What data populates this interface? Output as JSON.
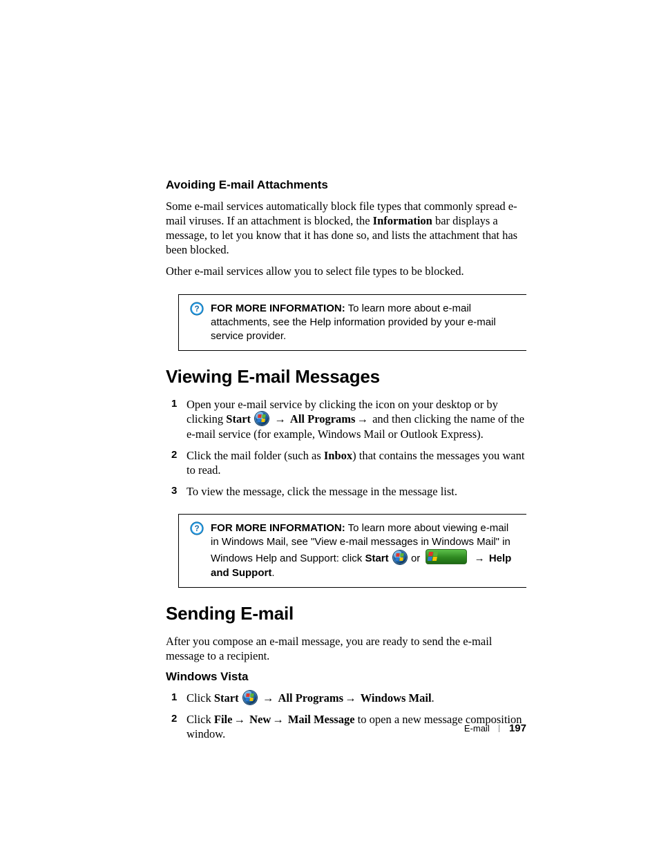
{
  "section1": {
    "heading": "Avoiding E-mail Attachments",
    "p1a": "Some e-mail services automatically block file types that commonly spread e-mail viruses. If an attachment is blocked, the ",
    "p1b": "Information",
    "p1c": " bar displays a message, to let you know that it has done so, and lists the attachment that has been blocked.",
    "p2": "Other e-mail services allow you to select file types to be blocked."
  },
  "note1": {
    "label": "FOR MORE INFORMATION:",
    "text": " To learn more about e-mail attachments, see the Help information provided by your e-mail service provider."
  },
  "section2": {
    "heading": "Viewing E-mail Messages",
    "step1a": "Open your e-mail service by clicking the icon on your desktop or by clicking ",
    "step1_start": "Start",
    "step1_arrow1": " → ",
    "step1_allprograms": "All Programs",
    "step1_arrow2": "→ ",
    "step1b": "and then clicking the name of the e-mail service (for example, Windows Mail or Outlook Express).",
    "step2a": "Click the mail folder (such as ",
    "step2_inbox": "Inbox",
    "step2b": ") that contains the messages you want to read.",
    "step3": "To view the message, click the message in the message list."
  },
  "note2": {
    "label": "FOR MORE INFORMATION:",
    "t1": " To learn more about viewing e-mail in Windows Mail, see \"View e-mail messages in Windows Mail\" in Windows Help and Support: click ",
    "start": "Start",
    "or": " or ",
    "arrow": " → ",
    "help": "Help and Support",
    "period": "."
  },
  "section3": {
    "heading": "Sending E-mail",
    "intro": "After you compose an e-mail message, you are ready to send the e-mail message to a recipient.",
    "sub": "Windows Vista",
    "s1a": "Click ",
    "s1_start": "Start",
    "s1_arrow1": " → ",
    "s1_all": "All Programs",
    "s1_arrow2": "→ ",
    "s1_wm": "Windows Mail",
    "s1_period": ".",
    "s2a": "Click ",
    "s2_file": "File",
    "s2_arr1": "→ ",
    "s2_new": "New",
    "s2_arr2": "→ ",
    "s2_mm": "Mail Message",
    "s2b": " to open a new message composition window."
  },
  "footer": {
    "chapter": "E-mail",
    "page": "197"
  }
}
